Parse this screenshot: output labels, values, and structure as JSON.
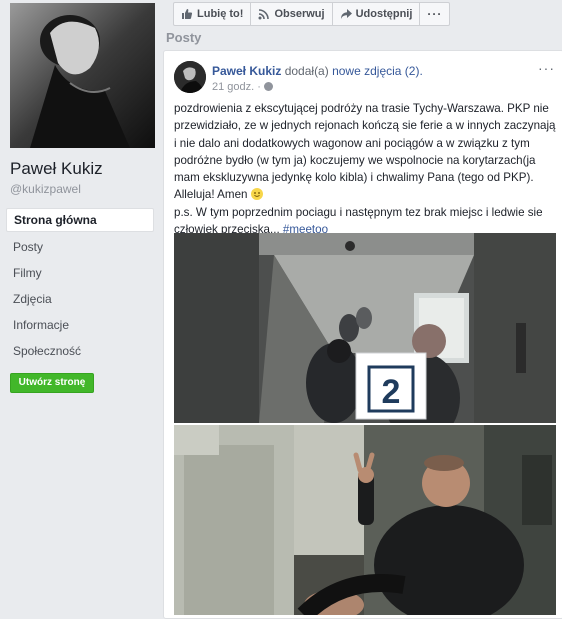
{
  "page": {
    "name": "Paweł Kukiz",
    "username": "@kukizpawel"
  },
  "nav": {
    "items": [
      {
        "label": "Strona główna",
        "active": true
      },
      {
        "label": "Posty"
      },
      {
        "label": "Filmy"
      },
      {
        "label": "Zdjęcia"
      },
      {
        "label": "Informacje"
      },
      {
        "label": "Społeczność"
      }
    ],
    "create_page": "Utwórz stronę"
  },
  "toolbar": {
    "like": "Lubię to!",
    "follow": "Obserwuj",
    "share": "Udostępnij",
    "more": "···"
  },
  "posts_heading": "Posty",
  "post": {
    "author": "Paweł Kukiz",
    "action": "dodał(a)",
    "new_photos": "nowe zdjęcia (2).",
    "time": "21 godz. ·",
    "menu": "···",
    "text_main": "pozdrowienia z ekscytującej podróży na trasie Tychy-Warszawa. PKP nie przewidziało, ze w jednych rejonach kończą sie ferie a w innych zaczynają i nie dalo ani dodatkowych wagonow ani pociągów a w związku z tym podróżne bydło (w tym ja) koczujemy we wspolnocie na korytarzach(ja mam ekskluzywna jedynkę kolo kibla) i chwalimy Pana (tego od PKP). Alleluja! Amen",
    "text_ps": "p.s. W tym poprzednim pociagu i następnym tez brak miejsc i ledwie sie człowiek przeciska...",
    "hashtag": "#meetoo",
    "photo_sign": "2"
  }
}
